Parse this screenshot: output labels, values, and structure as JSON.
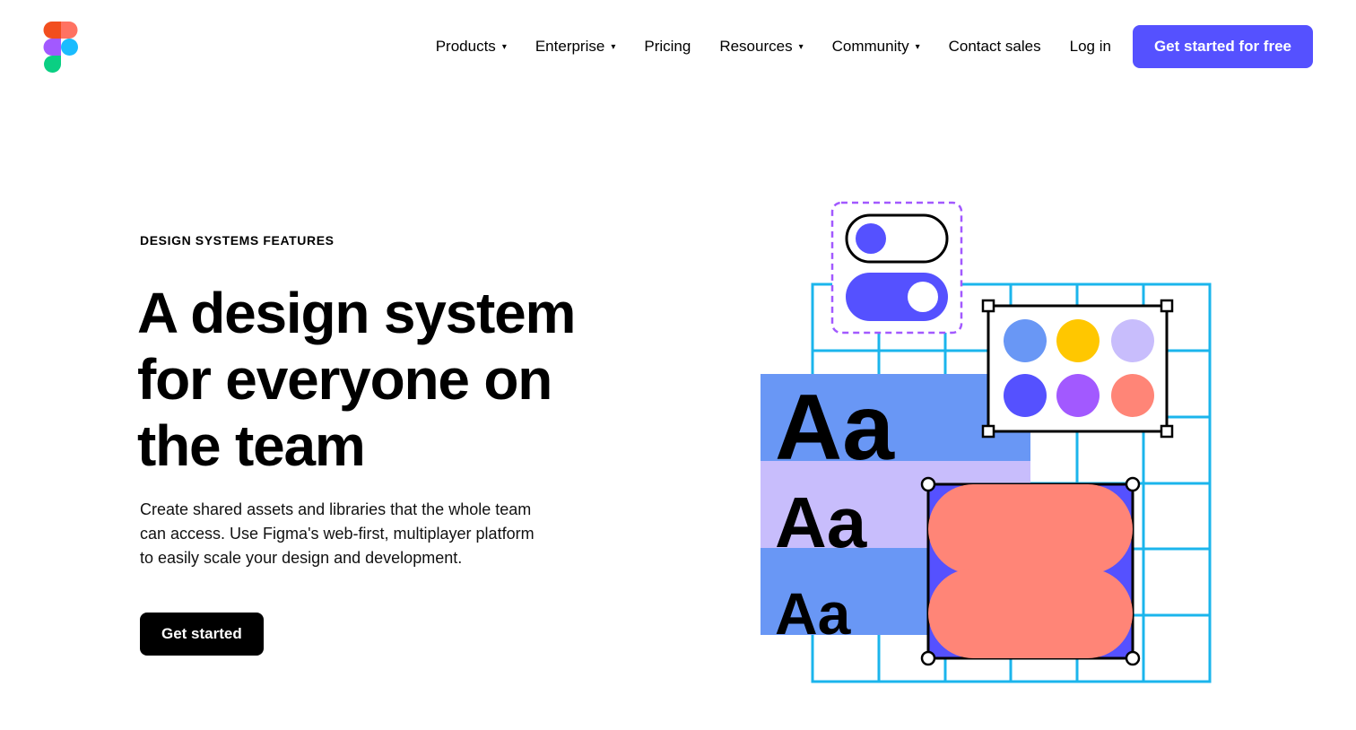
{
  "brand": {
    "logo_icon": "figma-logo-icon"
  },
  "nav": {
    "items": [
      {
        "label": "Products",
        "dropdown": true
      },
      {
        "label": "Enterprise",
        "dropdown": true
      },
      {
        "label": "Pricing",
        "dropdown": false
      },
      {
        "label": "Resources",
        "dropdown": true
      },
      {
        "label": "Community",
        "dropdown": true
      },
      {
        "label": "Contact sales",
        "dropdown": false
      },
      {
        "label": "Log in",
        "dropdown": false
      }
    ],
    "caret": "▾",
    "cta_label": "Get started for free"
  },
  "hero": {
    "eyebrow": "DESIGN SYSTEMS FEATURES",
    "headline_lines": [
      "A design system",
      "for everyone on",
      "the team"
    ],
    "body_lines": [
      "Create shared assets and libraries that the whole team",
      "can access. Use Figma's web-first, multiplayer platform",
      "to easily scale your design and development."
    ],
    "cta_label": "Get started"
  },
  "illustration": {
    "type_samples": [
      "Aa",
      "Aa",
      "Aa"
    ],
    "swatches": [
      "#6997f5",
      "#ffc700",
      "#c8bdfc",
      "#5551ff",
      "#a259ff",
      "#ff8577"
    ]
  },
  "colors": {
    "accent": "#5551ff",
    "grid": "#1bb5ec",
    "blue": "#6997f5",
    "lavender": "#c8bdfc",
    "coral": "#ff8577",
    "purple_dashed": "#a259ff"
  }
}
